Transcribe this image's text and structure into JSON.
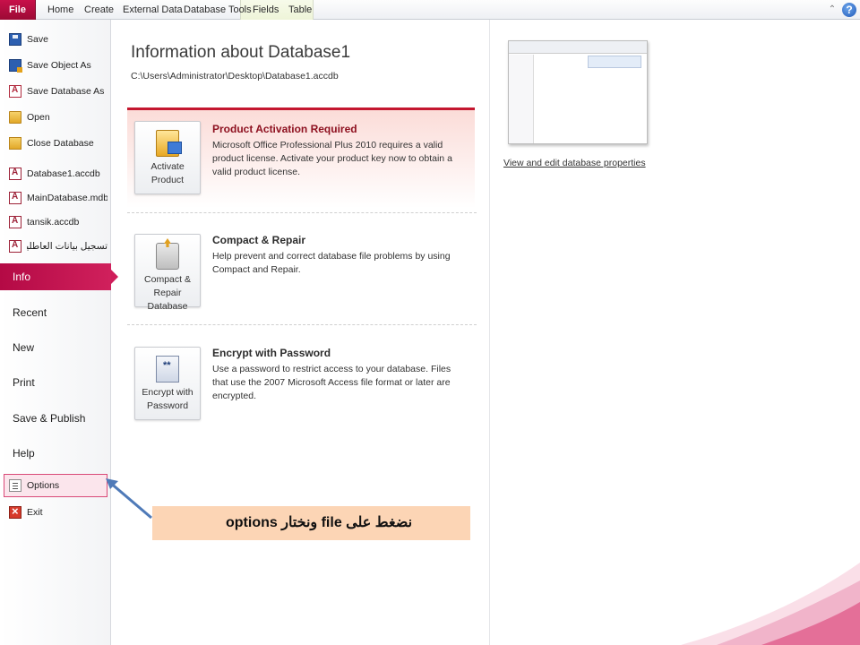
{
  "ribbon": {
    "tabs": [
      "File",
      "Home",
      "Create",
      "External Data",
      "Database Tools",
      "Fields",
      "Table"
    ]
  },
  "nav": {
    "save": "Save",
    "save_object_as": "Save Object As",
    "save_database_as": "Save Database As",
    "open": "Open",
    "close_database": "Close Database",
    "recent_files": [
      "Database1.accdb",
      "MainDatabase.mdb",
      "tansik.accdb",
      "تسجيل بيانات العاطلين.mdb"
    ],
    "info": "Info",
    "recent": "Recent",
    "new": "New",
    "print": "Print",
    "save_publish": "Save & Publish",
    "help": "Help",
    "options": "Options",
    "exit": "Exit"
  },
  "main": {
    "title": "Information about Database1",
    "path": "C:\\Users\\Administrator\\Desktop\\Database1.accdb",
    "activation": {
      "button_line1": "Activate",
      "button_line2": "Product",
      "title": "Product Activation Required",
      "desc": "Microsoft Office Professional Plus 2010 requires a valid product license. Activate your product key now to obtain a valid product license."
    },
    "compact": {
      "button_line1": "Compact &",
      "button_line2": "Repair Database",
      "title": "Compact & Repair",
      "desc": "Help prevent and correct database file problems by using Compact and Repair."
    },
    "encrypt": {
      "button_line1": "Encrypt with",
      "button_line2": "Password",
      "title": "Encrypt with Password",
      "desc": "Use a password to restrict access to your database. Files that use the 2007 Microsoft Access file format or later are encrypted."
    },
    "properties_link": "View and edit database properties"
  },
  "callout": {
    "text": "نضغط على file ونختار options"
  },
  "colors": {
    "accent": "#c8104a",
    "warning_border": "#c4172f",
    "callout_bg": "#fcd5b5",
    "arrow": "#4f7ab8"
  }
}
